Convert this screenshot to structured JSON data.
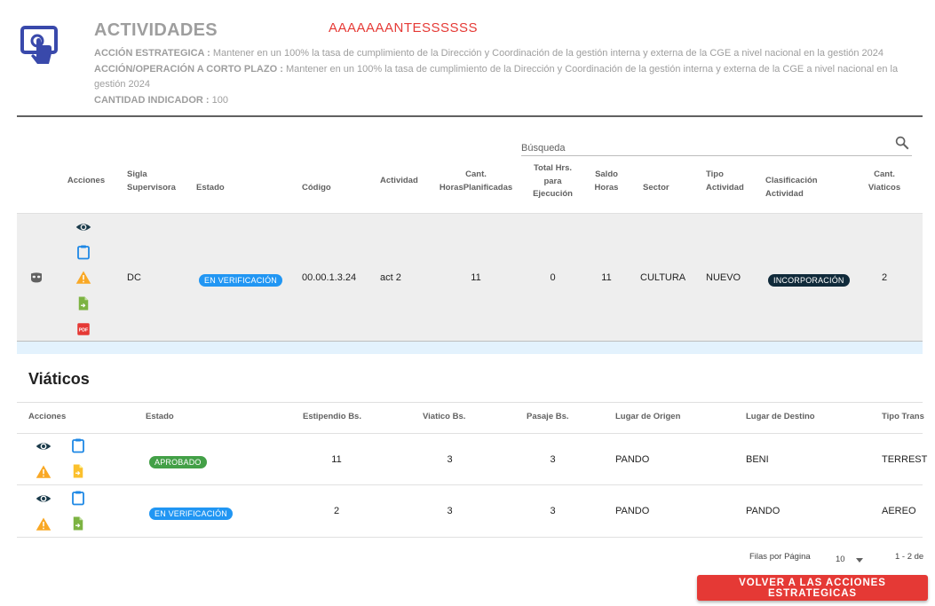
{
  "header": {
    "title": "ACTIVIDADES",
    "debug_text": "AAAAAAANTESSSSSS",
    "accion_estrategica_label": "ACCIÓN ESTRATEGICA :",
    "accion_estrategica_value": "Mantener en un 100% la tasa de cumplimiento de la Dirección y Coordinación de la gestión interna y externa de la CGE a nivel nacional en la gestión 2024",
    "accion_operacion_label": "ACCIÓN/OPERACIÓN A CORTO PLAZO :",
    "accion_operacion_value": "Mantener en un 100% la tasa de cumplimiento de la Dirección y Coordinación de la gestión interna y externa de la CGE a nivel nacional en la gestión 2024",
    "cantidad_label": "CANTIDAD INDICADOR :",
    "cantidad_value": "100"
  },
  "search": {
    "placeholder": "Búsqueda"
  },
  "activities_table": {
    "headers": {
      "acciones": "Acciones",
      "sigla_1": "Sigla",
      "sigla_2": "Supervisora",
      "estado": "Estado",
      "codigo": "Código",
      "actividad": "Actividad",
      "cant_horas_1": "Cant.",
      "cant_horas_2": "HorasPlanificadas",
      "total_hrs_1": "Total Hrs.",
      "total_hrs_2": "para",
      "total_hrs_3": "Ejecución",
      "saldo_1": "Saldo",
      "saldo_2": "Horas",
      "sector": "Sector",
      "tipo_1": "Tipo",
      "tipo_2": "Actividad",
      "clasif_1": "Clasificación",
      "clasif_2": "Actividad",
      "viaticos_1": "Cant.",
      "viaticos_2": "Viaticos"
    },
    "row": {
      "sigla": "DC",
      "estado": "EN VERIFICACIÓN",
      "codigo": "00.00.1.3.24",
      "actividad": "act 2",
      "cant_horas": "11",
      "total_hrs": "0",
      "saldo_horas": "11",
      "sector": "CULTURA",
      "tipo": "NUEVO",
      "clasificacion": "INCORPORACIÓN",
      "cant_viaticos": "2"
    }
  },
  "viaticos": {
    "title": "Viáticos",
    "headers": {
      "acciones": "Acciones",
      "estado": "Estado",
      "estipendio": "Estipendio Bs.",
      "viatico": "Viatico Bs.",
      "pasaje": "Pasaje Bs.",
      "origen": "Lugar de Origen",
      "destino": "Lugar de Destino",
      "tipo_transporte": "Tipo Trans"
    },
    "rows": [
      {
        "estado": "APROBADO",
        "estipendio": "11",
        "viatico": "3",
        "pasaje": "3",
        "origen": "PANDO",
        "destino": "BENI",
        "tipo_transporte": "TERREST"
      },
      {
        "estado": "EN VERIFICACIÓN",
        "estipendio": "2",
        "viatico": "3",
        "pasaje": "3",
        "origen": "PANDO",
        "destino": "PANDO",
        "tipo_transporte": "AEREO"
      }
    ],
    "pagination": {
      "rows_per_page_label": "Filas por Página",
      "rows_per_page_value": "10",
      "range": "1 - 2 de"
    }
  },
  "footer": {
    "back_button": "VOLVER A LAS ACCIONES ESTRATEGICAS"
  },
  "colors": {
    "header_icon": "#3949ab",
    "eye": "#1a3a4a",
    "clipboard": "#1e88e5",
    "warning": "#f9a825",
    "doc_green": "#7cb342",
    "doc_yellow": "#fbc02d",
    "pdf": "#e53935",
    "accent_red": "#e53935"
  },
  "icons": [
    "touch-screen-icon",
    "search-icon",
    "mask-icon",
    "eye-icon",
    "clipboard-icon",
    "warning-icon",
    "document-arrow-icon",
    "pdf-icon",
    "chevron-down-icon"
  ]
}
